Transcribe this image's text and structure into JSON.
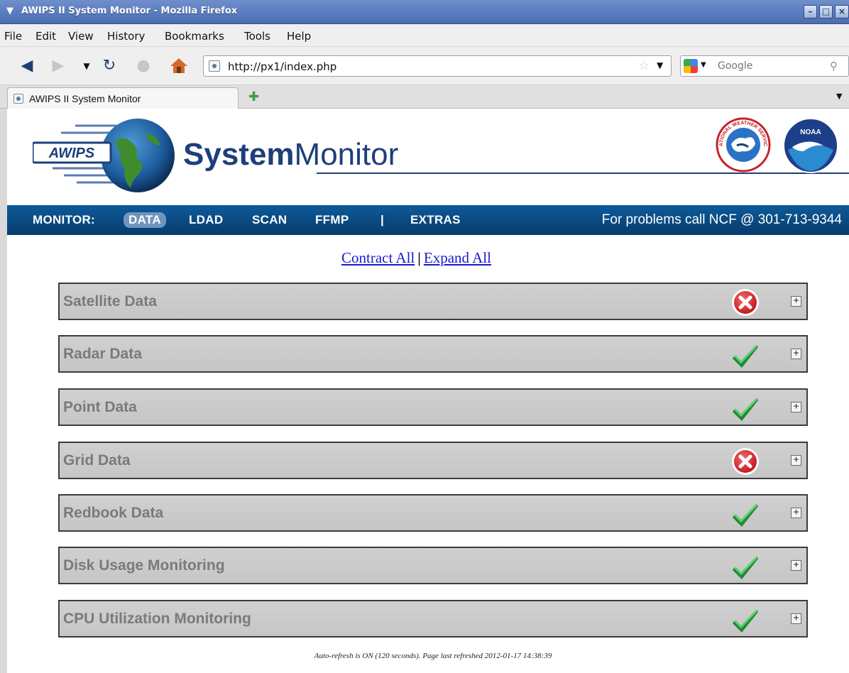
{
  "window": {
    "title": "AWIPS II System Monitor - Mozilla Firefox",
    "controls": [
      "minimize",
      "maximize",
      "close"
    ]
  },
  "menubar": {
    "items": [
      "File",
      "Edit",
      "View",
      "History",
      "Bookmarks",
      "Tools",
      "Help"
    ]
  },
  "navbar": {
    "url": "http://px1/index.php",
    "search_placeholder": "Google",
    "icons": [
      "back-icon",
      "forward-icon",
      "history-dropdown-icon",
      "reload-icon",
      "stop-icon",
      "home-icon"
    ]
  },
  "tabs": {
    "active_label": "AWIPS II System Monitor"
  },
  "header": {
    "logo_text": "AWIPS",
    "title_bold": "System",
    "title_light": "Monitor",
    "nws_text": "NATIONAL WEATHER SERVICE",
    "noaa_text": "NOAA"
  },
  "nav": {
    "label": "MONITOR:",
    "items": [
      "DATA",
      "LDAD",
      "SCAN",
      "FFMP",
      "|",
      "EXTRAS"
    ],
    "active": "DATA",
    "phone": "For problems call NCF @ 301-713-9344"
  },
  "toggle": {
    "contract": "Contract All",
    "separator": "|",
    "expand": "Expand All"
  },
  "rows": [
    {
      "label": "Satellite Data",
      "status": "error"
    },
    {
      "label": "Radar Data",
      "status": "ok"
    },
    {
      "label": "Point Data",
      "status": "ok"
    },
    {
      "label": "Grid Data",
      "status": "error"
    },
    {
      "label": "Redbook Data",
      "status": "ok"
    },
    {
      "label": "Disk Usage Monitoring",
      "status": "ok"
    },
    {
      "label": "CPU Utilization Monitoring",
      "status": "ok"
    }
  ],
  "footer": {
    "note": "Auto-refresh is ON (120 seconds). Page last refreshed 2012-01-17 14:38:39"
  },
  "colors": {
    "nav_band": "#0a4b82",
    "title_blue": "#1d3f7a",
    "row_bg": "#cccccc",
    "error_red": "#d8262a",
    "ok_green": "#2e9a3c"
  }
}
